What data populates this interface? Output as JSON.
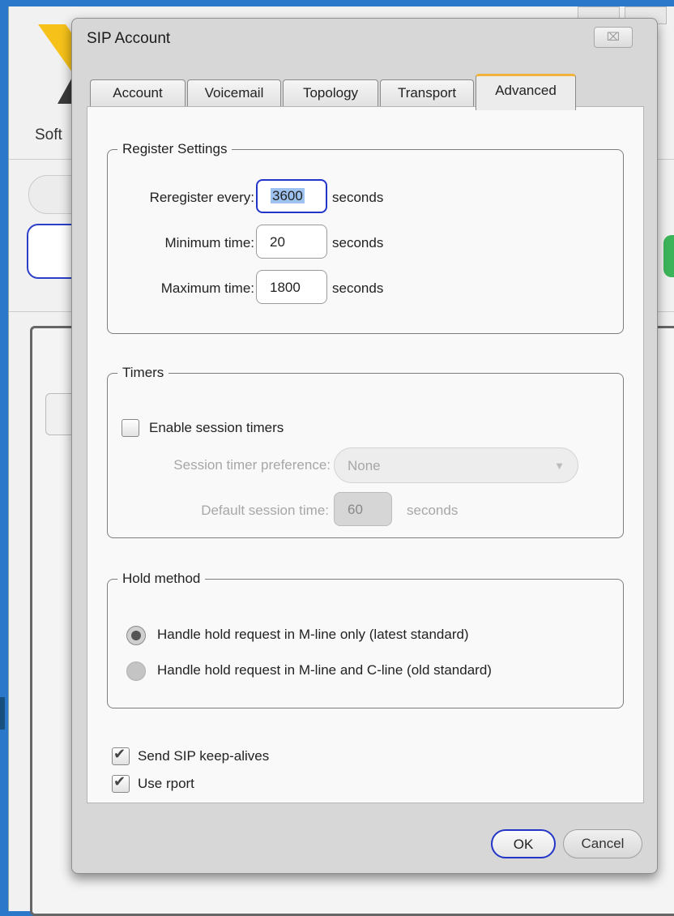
{
  "background": {
    "app_label_fragment": "Soft"
  },
  "dialog": {
    "title": "SIP Account",
    "close_glyph": "⌧"
  },
  "tabs": [
    {
      "label": "Account",
      "active": false
    },
    {
      "label": "Voicemail",
      "active": false
    },
    {
      "label": "Topology",
      "active": false
    },
    {
      "label": "Transport",
      "active": false
    },
    {
      "label": "Advanced",
      "active": true
    }
  ],
  "register": {
    "legend": "Register Settings",
    "reregister_label": "Reregister every:",
    "reregister_value": "3600",
    "minimum_label": "Minimum time:",
    "minimum_value": "20",
    "maximum_label": "Maximum time:",
    "maximum_value": "1800",
    "unit": "seconds"
  },
  "timers": {
    "legend": "Timers",
    "enable_label": "Enable session timers",
    "enable_checked": false,
    "preference_label": "Session timer preference:",
    "preference_value": "None",
    "default_time_label": "Default session time:",
    "default_time_value": "60",
    "unit": "seconds"
  },
  "hold": {
    "legend": "Hold method",
    "option_mline": "Handle hold request in M-line only (latest standard)",
    "option_cline": "Handle hold request in M-line and C-line (old standard)",
    "selected": "mline"
  },
  "options": {
    "keepalive_label": "Send SIP keep-alives",
    "keepalive_checked": true,
    "rport_label": "Use rport",
    "rport_checked": true
  },
  "buttons": {
    "ok": "OK",
    "cancel": "Cancel"
  },
  "colors": {
    "accent_focus": "#2235c8",
    "active_tab": "#f2b33d",
    "desktop": "#2b77c9"
  }
}
